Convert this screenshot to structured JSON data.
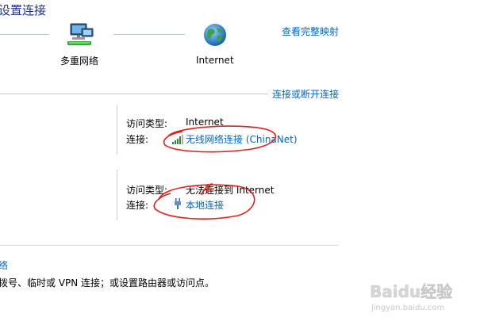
{
  "header": {
    "title": "设置连接",
    "view_full_map": "查看完整映射"
  },
  "network_map": {
    "node1_label": "多重网络",
    "node1_icon": "network-computer-icon",
    "node2_label": "Internet",
    "node2_icon": "globe-icon"
  },
  "active_networks": {
    "connect_disconnect": "连接或断开连接",
    "network1": {
      "access_type_label": "访问类型:",
      "access_type_value": "Internet",
      "connections_label": "连接:",
      "connection_name": "无线网络连接 (ChinaNet)",
      "connection_icon": "wifi-signal-icon"
    },
    "network2": {
      "access_type_label": "访问类型:",
      "access_type_value": "无法连接到 Internet",
      "connections_label": "连接:",
      "connection_name": "本地连接",
      "connection_icon": "ethernet-plug-icon"
    }
  },
  "change_settings": {
    "task_title": "络",
    "task_desc": "拨号、临时或 VPN 连接；或设置路由器或访问点。"
  },
  "watermark": {
    "text": "Baidu经验",
    "url": "jingyan.baidu.com"
  },
  "colors": {
    "title": "#1e3287",
    "link": "#0066cc",
    "annotation": "#e0201a"
  }
}
